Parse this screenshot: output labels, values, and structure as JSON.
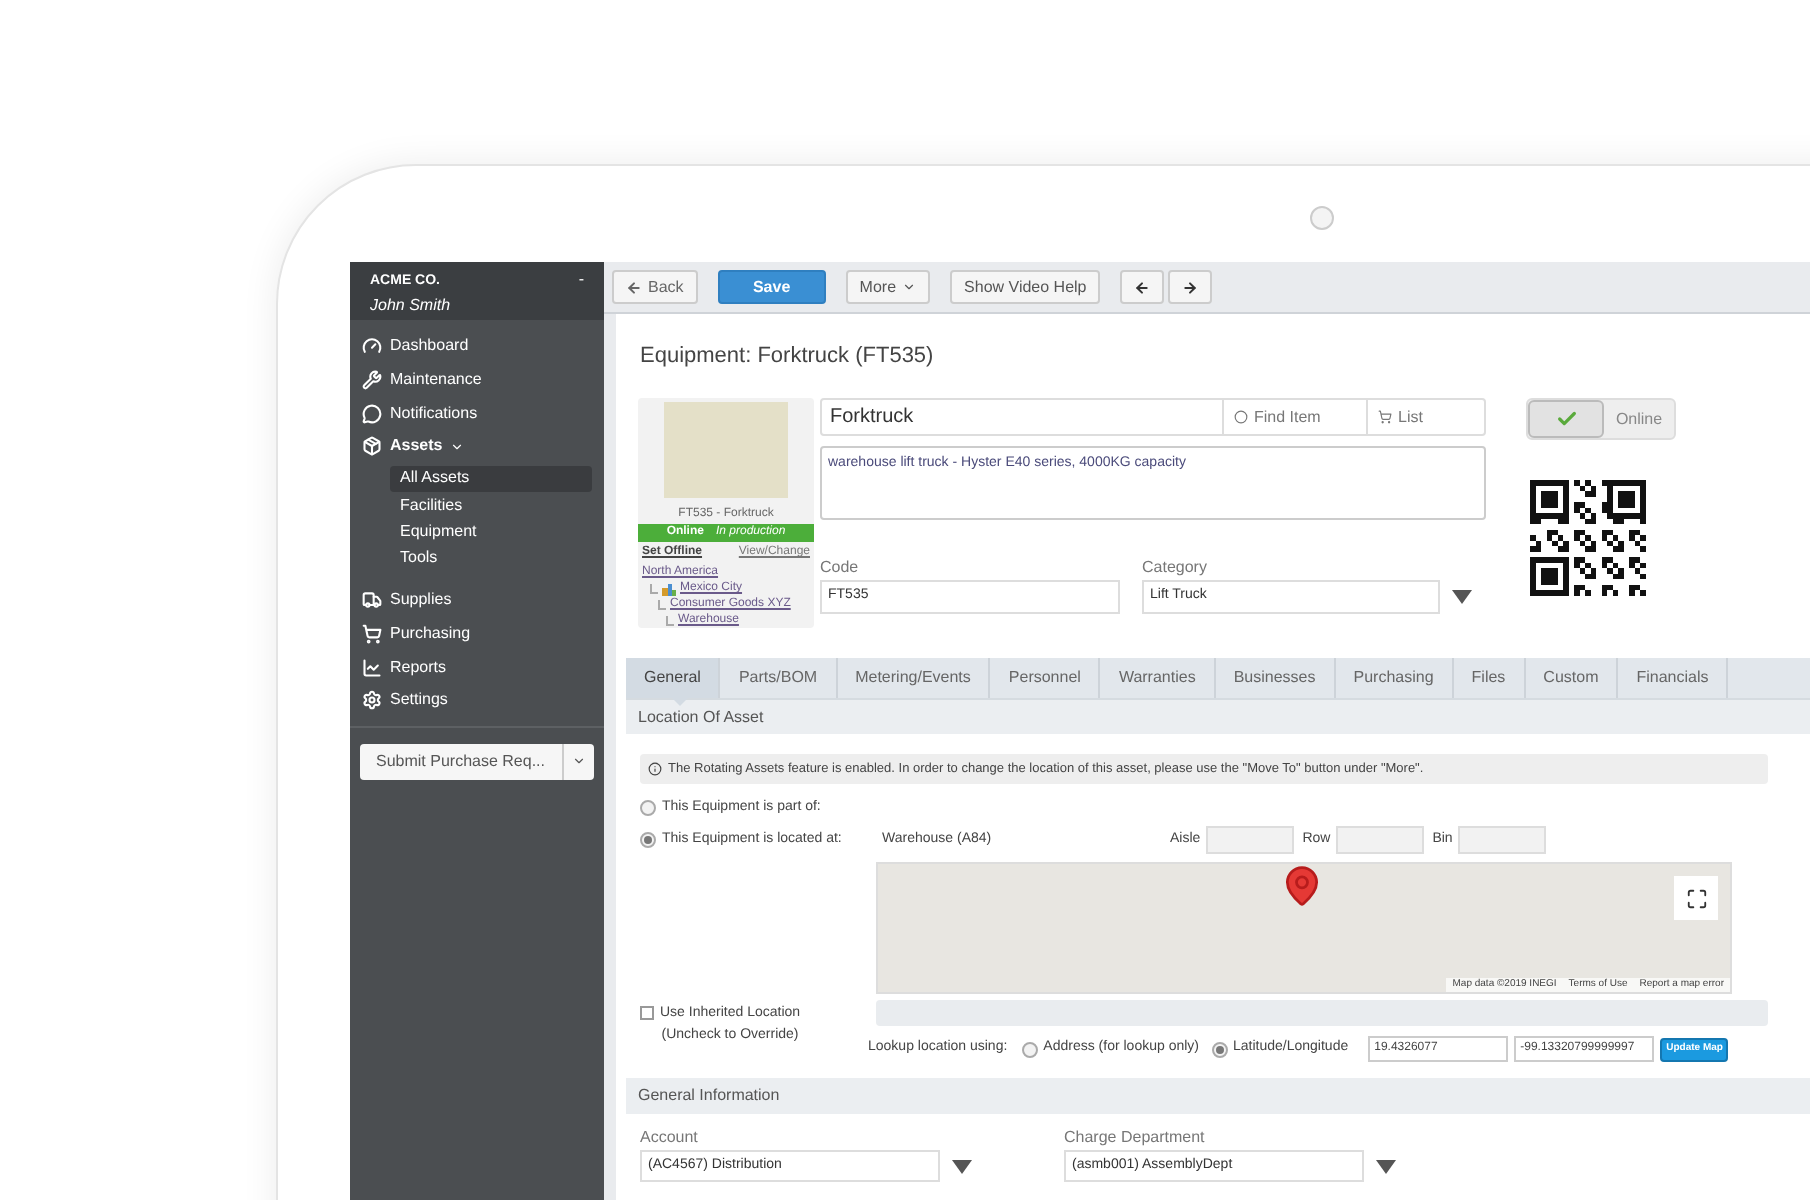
{
  "sidebar": {
    "company": "ACME CO.",
    "user": "John Smith",
    "collapse": "-",
    "items": [
      {
        "label": "Dashboard"
      },
      {
        "label": "Maintenance"
      },
      {
        "label": "Notifications"
      },
      {
        "label": "Assets",
        "expanded": true,
        "children": [
          {
            "label": "All Assets",
            "selected": true
          },
          {
            "label": "Facilities",
            "selected": false
          },
          {
            "label": "Equipment",
            "selected": false
          },
          {
            "label": "Tools",
            "selected": false
          }
        ]
      },
      {
        "label": "Supplies"
      },
      {
        "label": "Purchasing"
      },
      {
        "label": "Reports"
      },
      {
        "label": "Settings"
      }
    ],
    "submit_button": "Submit Purchase Req..."
  },
  "toolbar": [
    {
      "kind": "back",
      "label": "Back"
    },
    {
      "kind": "primary",
      "label": "Save"
    },
    {
      "kind": "dropdown",
      "label": "More"
    },
    {
      "kind": "plain",
      "label": "Show Video Help"
    },
    {
      "kind": "prev"
    },
    {
      "kind": "next"
    }
  ],
  "title": "Equipment: Forktruck (FT535)",
  "asset_card": {
    "caption": "FT535 - Forktruck",
    "status": "Online",
    "phase": "In production",
    "set_offline": "Set Offline",
    "view_change": "View/Change",
    "location_tree": [
      {
        "label": "North America",
        "children": [
          {
            "label": "Mexico City",
            "children": [
              {
                "label": "Consumer Goods XYZ",
                "children": [
                  {
                    "label": "Warehouse"
                  }
                ]
              }
            ]
          }
        ]
      }
    ]
  },
  "name_field": {
    "value": "Forktruck",
    "find_item": "Find Item",
    "list": "List"
  },
  "description": "warehouse lift truck - Hyster E40 series, 4000KG capacity",
  "code": {
    "label": "Code",
    "value": "FT535"
  },
  "category": {
    "label": "Category",
    "value": "Lift Truck"
  },
  "online_toggle": {
    "checked": true,
    "label": "Online"
  },
  "tabs": [
    {
      "label": "General",
      "selected": true
    },
    {
      "label": "Parts/BOM",
      "selected": false
    },
    {
      "label": "Metering/Events",
      "selected": false
    },
    {
      "label": "Personnel",
      "selected": false
    },
    {
      "label": "Warranties",
      "selected": false
    },
    {
      "label": "Businesses",
      "selected": false
    },
    {
      "label": "Purchasing",
      "selected": false
    },
    {
      "label": "Files",
      "selected": false
    },
    {
      "label": "Custom",
      "selected": false
    },
    {
      "label": "Financials",
      "selected": false
    }
  ],
  "location_section": {
    "heading": "Location Of Asset",
    "info": "The Rotating Assets feature is enabled. In order to change the location of this asset, please use the \"Move To\" button under \"More\".",
    "placement": [
      {
        "label": "This Equipment is part of:",
        "selected": false
      },
      {
        "label": "This Equipment is located at:",
        "selected": true,
        "value": "Warehouse (A84)"
      }
    ],
    "bins": [
      {
        "label": "Aisle"
      },
      {
        "label": "Row"
      },
      {
        "label": "Bin"
      }
    ],
    "map_attribution": [
      "Map data ©2019 INEGI",
      "Terms of Use",
      "Report a map error"
    ],
    "inherited": {
      "checked": false,
      "label": "Use Inherited Location",
      "note": "(Uncheck to Override)"
    },
    "lookup_label": "Lookup location using:",
    "lookup_options": [
      {
        "label": "Address (for lookup only)",
        "selected": false
      },
      {
        "label": "Latitude/Longitude",
        "selected": true
      }
    ],
    "latitude": "19.4326077",
    "longitude": "-99.13320799999997",
    "update_button": "Update Map"
  },
  "general_section": {
    "heading": "General Information",
    "fields": [
      {
        "label": "Account",
        "value": "(AC4567) Distribution"
      },
      {
        "label": "Charge Department",
        "value": "(asmb001) AssemblyDept"
      }
    ]
  }
}
